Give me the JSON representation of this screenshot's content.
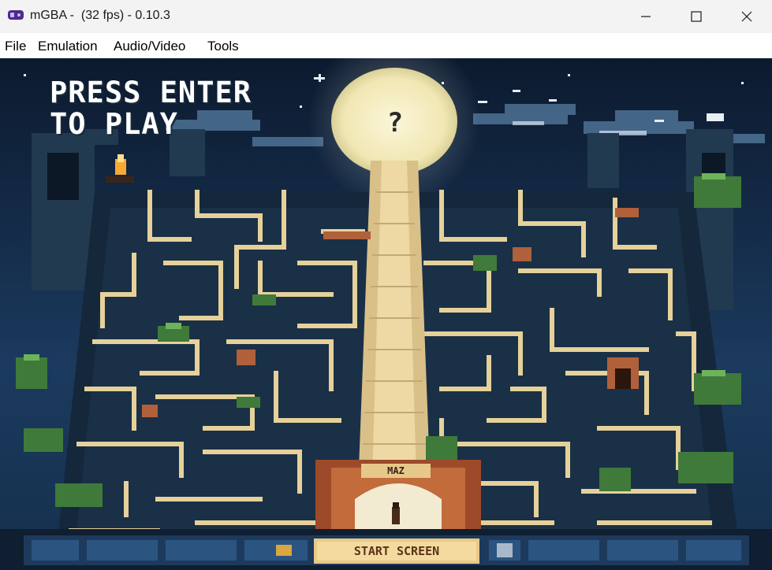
{
  "window": {
    "title": "mGBA -  (32 fps) - 0.10.3",
    "app_icon": "mgba-icon",
    "controls": [
      "minimize-icon",
      "maximize-icon",
      "close-icon"
    ]
  },
  "menu": {
    "items": [
      {
        "label": "File"
      },
      {
        "label": "Emulation"
      },
      {
        "label": "Audio/Video"
      },
      {
        "label": "Tools"
      }
    ]
  },
  "game": {
    "prompt_line1": "PRESS ENTER",
    "prompt_line2": "TO PLAY",
    "sign_label": "MAZ",
    "start_button": "START SCREEN",
    "moon_symbol": "?",
    "colors": {
      "sky": "#13263f",
      "moon": "#f6efc4",
      "path": "#e8d39b",
      "wall_dark": "#0f1c2c",
      "hud": "#1d3a5c"
    }
  }
}
